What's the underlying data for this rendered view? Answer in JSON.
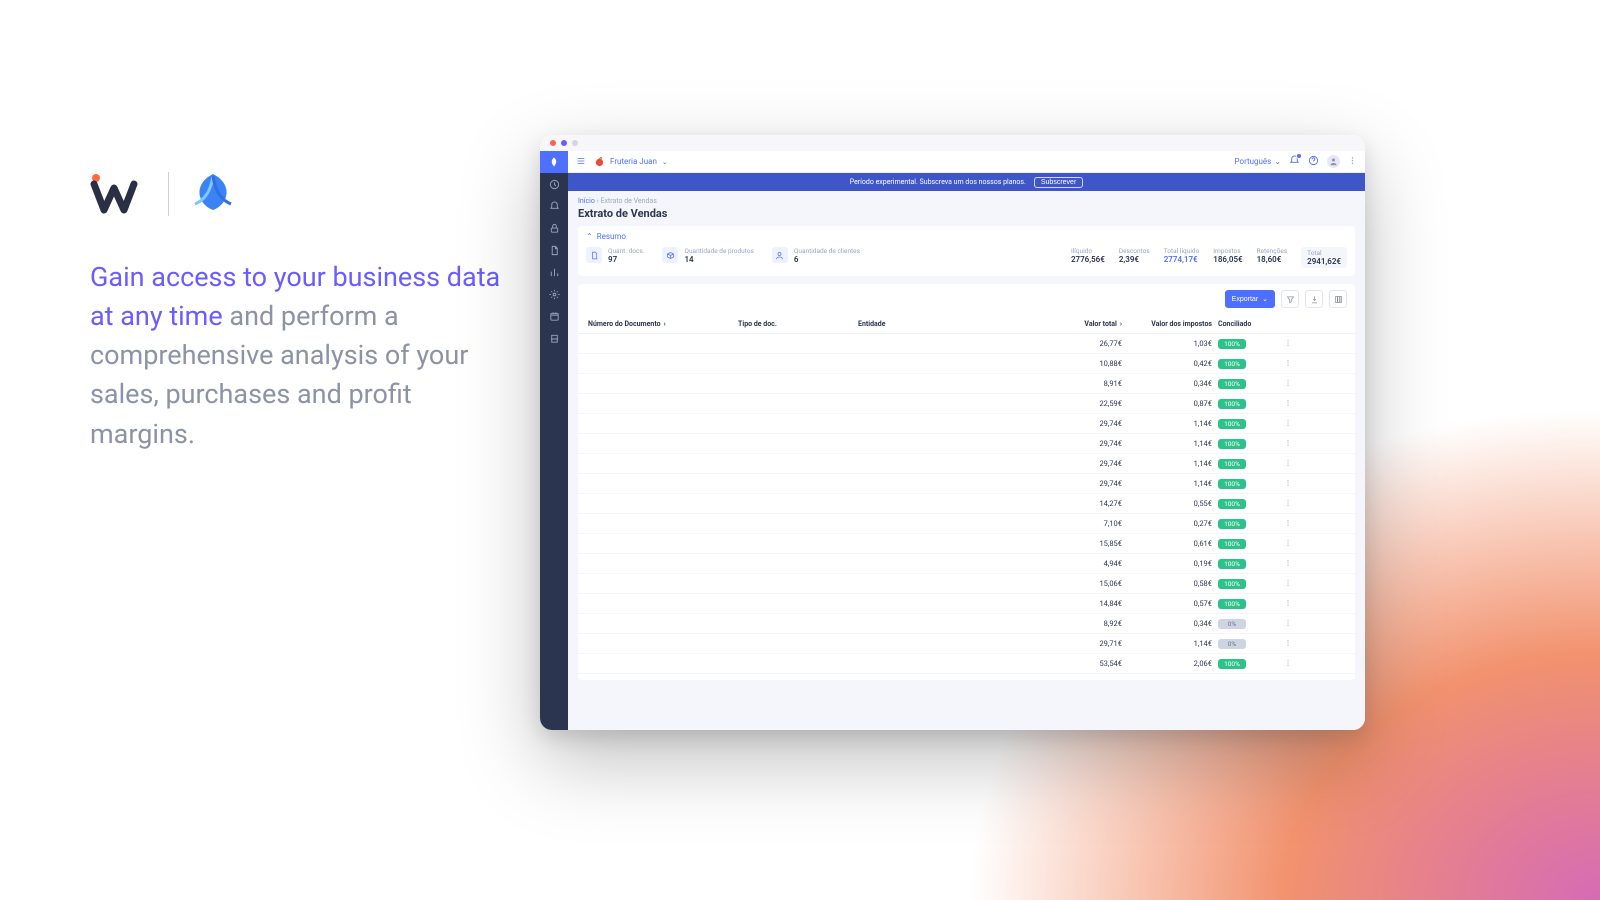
{
  "marketing": {
    "line1_purple": "Gain access to your business data at any time ",
    "line1_grey": "and perform a comprehensive analysis of your sales, purchases and profit margins."
  },
  "topbar": {
    "store_name": "Fruteria Juan",
    "language": "Português"
  },
  "trial": {
    "message": "Período experimental. Subscreva um dos nossos planos.",
    "cta": "Subscrever"
  },
  "breadcrumbs": {
    "home": "Início",
    "current": "Extrato de Vendas"
  },
  "page": {
    "title": "Extrato de Vendas",
    "resume_label": "Resumo"
  },
  "summary": {
    "docs": {
      "label": "Quant. docs.",
      "value": "97"
    },
    "products": {
      "label": "Quantidade de produtos",
      "value": "14"
    },
    "clients": {
      "label": "Quantidade de clientes",
      "value": "6"
    },
    "liquido": {
      "label": "Ilíquido",
      "value": "2776,56€"
    },
    "descontos": {
      "label": "Descontos",
      "value": "2,39€"
    },
    "totalliq": {
      "label": "Total líquido",
      "value": "2774,17€"
    },
    "impostos": {
      "label": "Impostos",
      "value": "186,05€"
    },
    "retencoes": {
      "label": "Retenções",
      "value": "18,60€"
    },
    "total": {
      "label": "Total",
      "value": "2941,62€"
    }
  },
  "table": {
    "export_label": "Exportar",
    "columns": {
      "docnum": "Número do Documento",
      "doctype": "Tipo de doc.",
      "entity": "Entidade",
      "total": "Valor total",
      "taxes": "Valor dos impostos",
      "concil": "Conciliado"
    },
    "rows": [
      {
        "total": "26,77€",
        "tax": "1,03€",
        "concil": "100%",
        "concil_class": "green",
        "phb": "b"
      },
      {
        "total": "10,88€",
        "tax": "0,42€",
        "concil": "100%",
        "concil_class": "green",
        "phb": "b"
      },
      {
        "total": "8,91€",
        "tax": "0,34€",
        "concil": "100%",
        "concil_class": "green",
        "phb": "b"
      },
      {
        "total": "22,59€",
        "tax": "0,87€",
        "concil": "100%",
        "concil_class": "green",
        "phb": "b"
      },
      {
        "total": "29,74€",
        "tax": "1,14€",
        "concil": "100%",
        "concil_class": "green",
        "phb": "d"
      },
      {
        "total": "29,74€",
        "tax": "1,14€",
        "concil": "100%",
        "concil_class": "green",
        "phb": "b"
      },
      {
        "total": "29,74€",
        "tax": "1,14€",
        "concil": "100%",
        "concil_class": "green",
        "phb": "d"
      },
      {
        "total": "29,74€",
        "tax": "1,14€",
        "concil": "100%",
        "concil_class": "green",
        "phb": "b"
      },
      {
        "total": "14,27€",
        "tax": "0,55€",
        "concil": "100%",
        "concil_class": "green",
        "phb": "b"
      },
      {
        "total": "7,10€",
        "tax": "0,27€",
        "concil": "100%",
        "concil_class": "green",
        "phb": "d"
      },
      {
        "total": "15,85€",
        "tax": "0,61€",
        "concil": "100%",
        "concil_class": "green",
        "phb": "d"
      },
      {
        "total": "4,94€",
        "tax": "0,19€",
        "concil": "100%",
        "concil_class": "green",
        "phb": "d"
      },
      {
        "total": "15,06€",
        "tax": "0,58€",
        "concil": "100%",
        "concil_class": "green",
        "phb": "d"
      },
      {
        "total": "14,84€",
        "tax": "0,57€",
        "concil": "100%",
        "concil_class": "green",
        "phb": "d"
      },
      {
        "total": "8,92€",
        "tax": "0,34€",
        "concil": "0%",
        "concil_class": "grey",
        "phb": "d"
      },
      {
        "total": "29,71€",
        "tax": "1,14€",
        "concil": "0%",
        "concil_class": "grey",
        "phb": "d"
      },
      {
        "total": "53,54€",
        "tax": "2,06€",
        "concil": "100%",
        "concil_class": "green",
        "phb": "b"
      }
    ]
  }
}
